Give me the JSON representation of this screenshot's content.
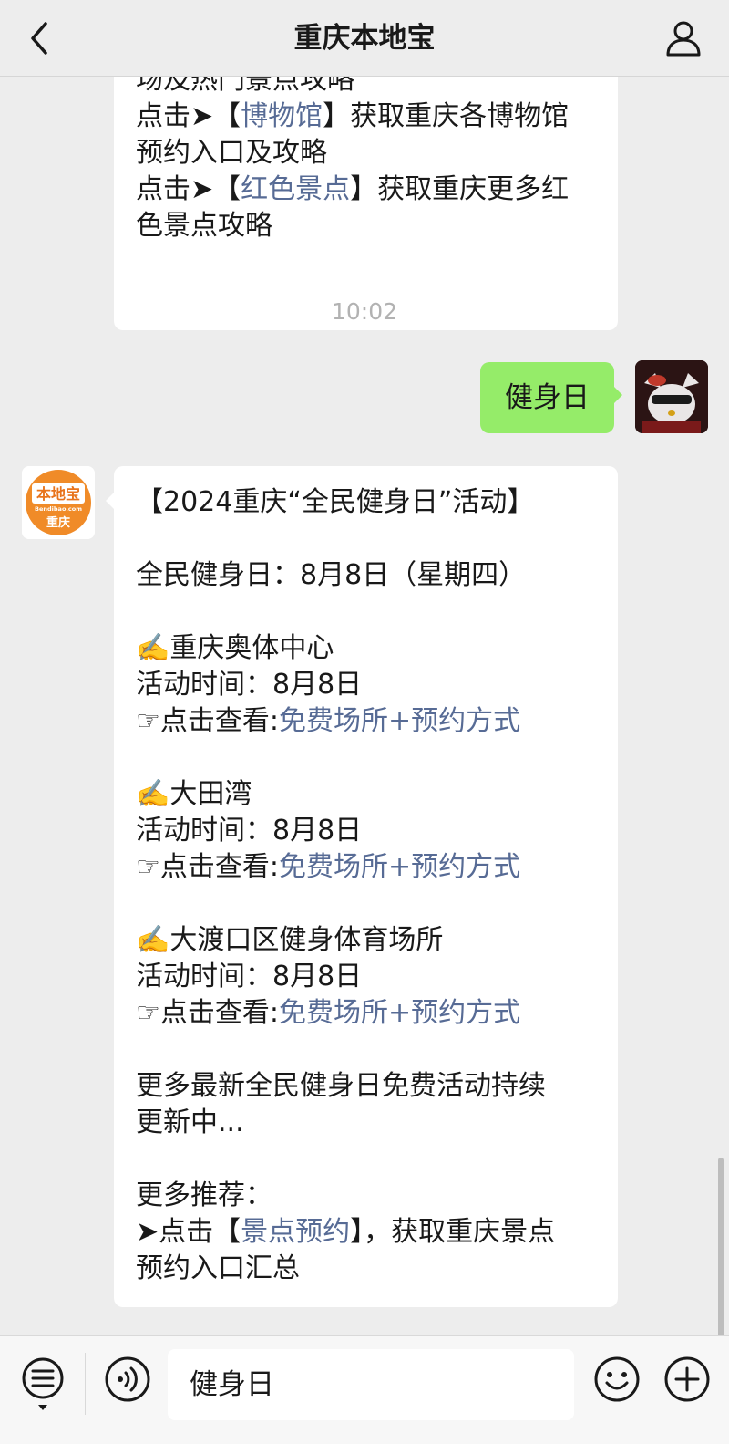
{
  "header": {
    "title": "重庆本地宝"
  },
  "earlier_message": {
    "lines": [
      [
        {
          "t": "场及热门景点攻略"
        }
      ],
      [
        {
          "t": "点击➤【"
        },
        {
          "t": "博物馆",
          "link": true
        },
        {
          "t": "】获取重庆各博物馆"
        }
      ],
      [
        {
          "t": "预约入口及攻略"
        }
      ],
      [
        {
          "t": "点击➤【"
        },
        {
          "t": "红色景点",
          "link": true
        },
        {
          "t": "】获取重庆更多红"
        }
      ],
      [
        {
          "t": "色景点攻略"
        }
      ]
    ]
  },
  "timestamp": "10:02",
  "sent_message": {
    "text": "健身日"
  },
  "bot_avatar": {
    "logo_text": "本地宝",
    "site_text": "Bendibao.com",
    "city_text": "重庆"
  },
  "reply_message": {
    "lines": [
      [
        {
          "t": "【2024重庆“全民健身日”活动】"
        }
      ],
      [],
      [
        {
          "t": "全民健身日：8月8日（星期四）"
        }
      ],
      [],
      [
        {
          "t": "✍️重庆奥体中心"
        }
      ],
      [
        {
          "t": "活动时间：8月8日"
        }
      ],
      [
        {
          "t": "☞点击查看:"
        },
        {
          "t": "免费场所+预约方式",
          "link": true
        }
      ],
      [],
      [
        {
          "t": "✍️大田湾"
        }
      ],
      [
        {
          "t": "活动时间：8月8日"
        }
      ],
      [
        {
          "t": "☞点击查看:"
        },
        {
          "t": "免费场所+预约方式",
          "link": true
        }
      ],
      [],
      [
        {
          "t": "✍️大渡口区健身体育场所"
        }
      ],
      [
        {
          "t": "活动时间：8月8日"
        }
      ],
      [
        {
          "t": "☞点击查看:"
        },
        {
          "t": "免费场所+预约方式",
          "link": true
        }
      ],
      [],
      [
        {
          "t": "更多最新全民健身日免费活动持续"
        }
      ],
      [
        {
          "t": "更新中..."
        }
      ],
      [],
      [
        {
          "t": "更多推荐："
        }
      ],
      [
        {
          "t": "➤点击【"
        },
        {
          "t": "景点预约",
          "link": true
        },
        {
          "t": "】，获取重庆景点"
        }
      ],
      [
        {
          "t": "预约入口汇总"
        }
      ]
    ]
  },
  "input": {
    "value": "健身日"
  },
  "colors": {
    "link": "#576b95",
    "sent_bubble": "#95ec69",
    "background": "#ededed"
  },
  "icons": [
    "back-icon",
    "profile-icon",
    "menu-icon",
    "voice-icon",
    "emoji-icon",
    "plus-icon"
  ]
}
